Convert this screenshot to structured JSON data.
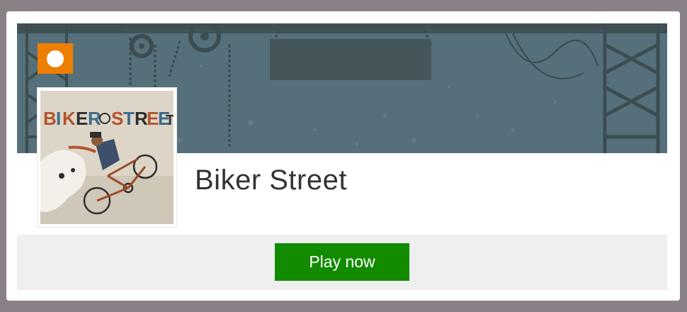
{
  "game": {
    "title": "Biker Street",
    "thumbnail_alt": "BIKER STREET"
  },
  "actions": {
    "back_icon": "chevron-left-icon",
    "play_label": "Play now"
  },
  "colors": {
    "page_bg": "#8a8088",
    "banner_bg": "#55707a",
    "back_button": "#ee7e00",
    "play_button": "#128b00",
    "bottom_bar": "#efefef"
  }
}
